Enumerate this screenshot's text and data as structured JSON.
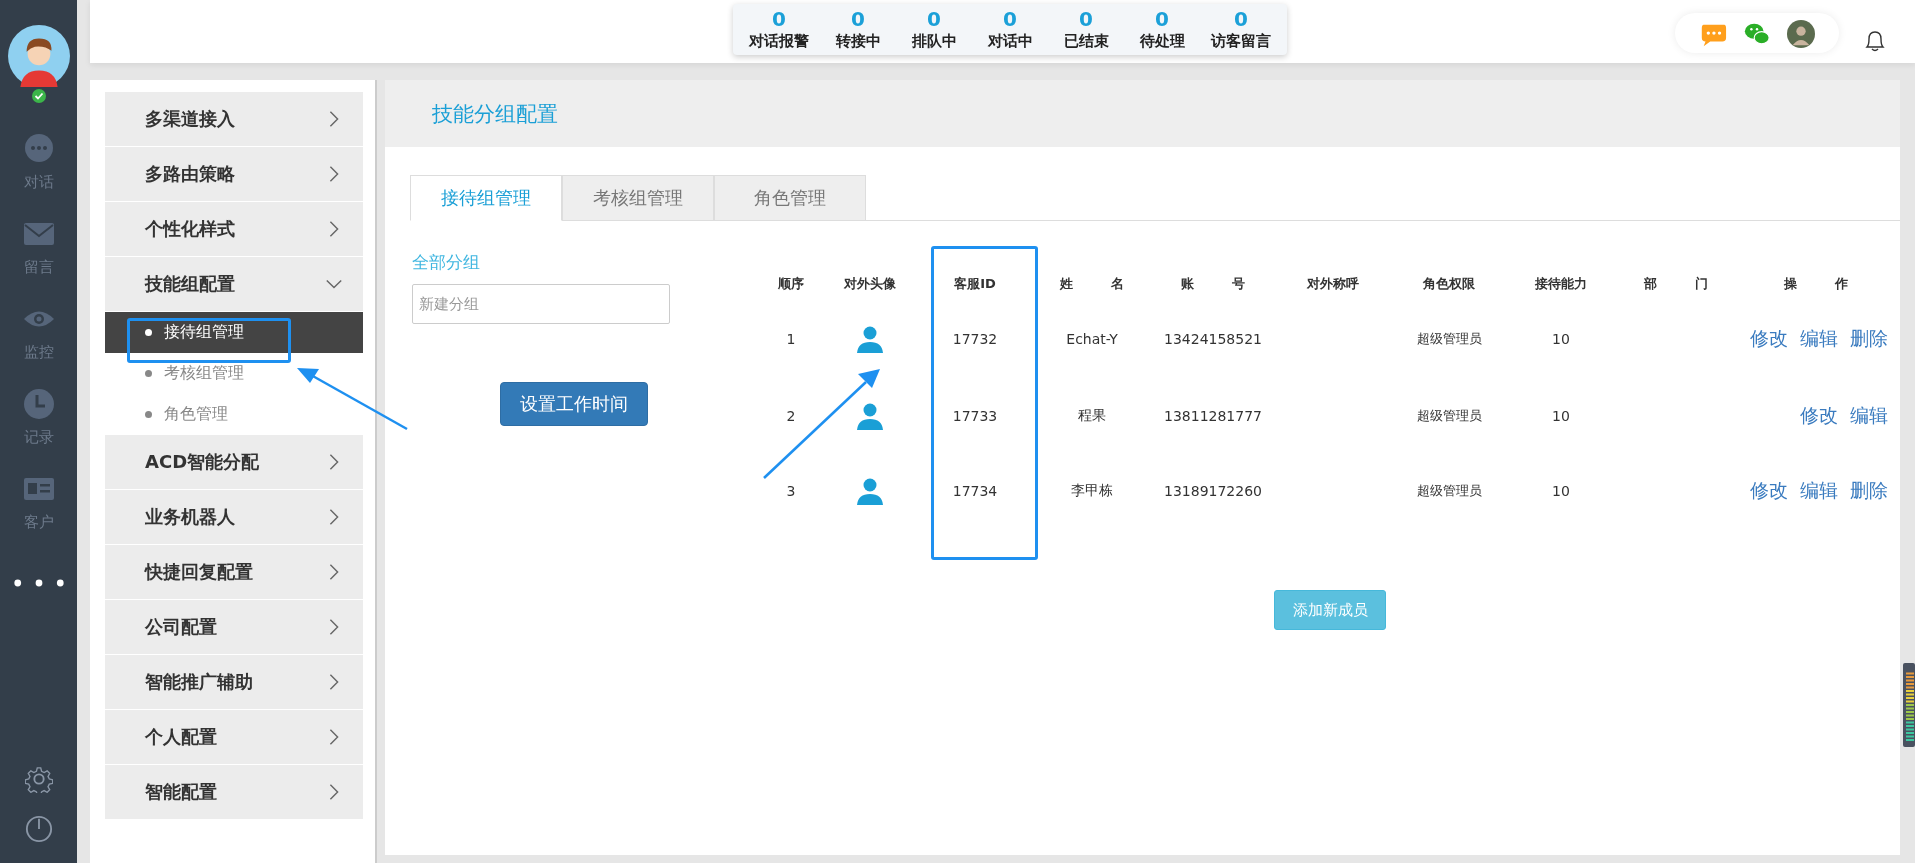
{
  "nav": {
    "online": true,
    "items": [
      {
        "kind": "chat",
        "label": "对话"
      },
      {
        "kind": "mail",
        "label": "留言"
      },
      {
        "kind": "eye",
        "label": "监控"
      },
      {
        "kind": "clock",
        "label": "记录"
      },
      {
        "kind": "card",
        "label": "客户"
      }
    ]
  },
  "stats": [
    {
      "count": "0",
      "label": "对话报警"
    },
    {
      "count": "0",
      "label": "转接中"
    },
    {
      "count": "0",
      "label": "排队中"
    },
    {
      "count": "0",
      "label": "对话中"
    },
    {
      "count": "0",
      "label": "已结束"
    },
    {
      "count": "0",
      "label": "待处理"
    },
    {
      "count": "0",
      "label": "访客留言"
    }
  ],
  "menu": [
    {
      "label": "多渠道接入",
      "expanded": false
    },
    {
      "label": "多路由策略",
      "expanded": false
    },
    {
      "label": "个性化样式",
      "expanded": false
    },
    {
      "label": "技能组配置",
      "expanded": true,
      "children": [
        {
          "label": "接待组管理",
          "selected": true
        },
        {
          "label": "考核组管理",
          "selected": false
        },
        {
          "label": "角色管理",
          "selected": false
        }
      ]
    },
    {
      "label": "ACD智能分配",
      "expanded": false
    },
    {
      "label": "业务机器人",
      "expanded": false
    },
    {
      "label": "快捷回复配置",
      "expanded": false
    },
    {
      "label": "公司配置",
      "expanded": false
    },
    {
      "label": "智能推广辅助",
      "expanded": false
    },
    {
      "label": "个人配置",
      "expanded": false
    },
    {
      "label": "智能配置",
      "expanded": false
    }
  ],
  "page_title": "技能分组配置",
  "tabs": [
    {
      "label": "接待组管理",
      "selected": true
    },
    {
      "label": "考核组管理",
      "selected": false
    },
    {
      "label": "角色管理",
      "selected": false
    }
  ],
  "groups": {
    "title": "全部分组",
    "placeholder": "新建分组",
    "button": "设置工作时间"
  },
  "table": {
    "columns": [
      "顺序",
      "对外头像",
      "客服ID",
      "姓 名",
      "账 号",
      "对外称呼",
      "角色权限",
      "接待能力",
      "部 门",
      "操 作"
    ],
    "rows": [
      {
        "order": "1",
        "id": "17732",
        "name": "Echat-Y",
        "account": "13424158521",
        "role": "超级管理员",
        "capacity": "10",
        "actions": [
          "修改",
          "编辑",
          "删除"
        ]
      },
      {
        "order": "2",
        "id": "17733",
        "name": "程果",
        "account": "13811281777",
        "role": "超级管理员",
        "capacity": "10",
        "actions": [
          "修改",
          "编辑"
        ]
      },
      {
        "order": "3",
        "id": "17734",
        "name": "李甲栋",
        "account": "13189172260",
        "role": "超级管理员",
        "capacity": "10",
        "actions": [
          "修改",
          "编辑",
          "删除"
        ]
      }
    ]
  },
  "add_button": "添加新成员"
}
